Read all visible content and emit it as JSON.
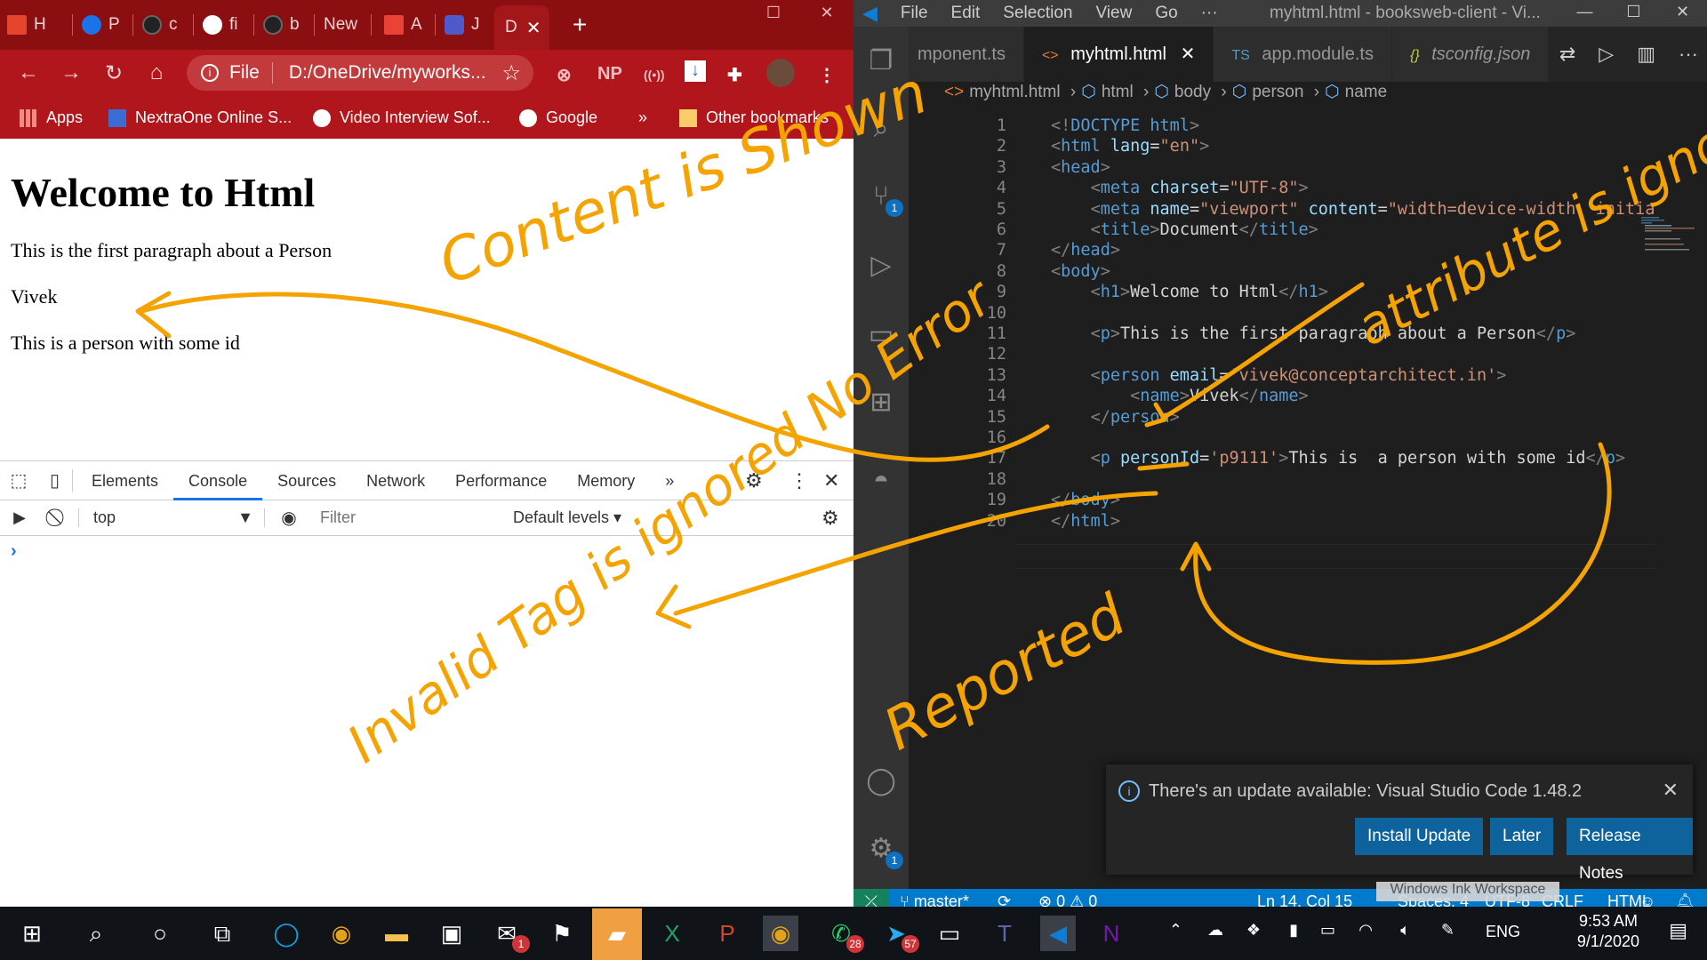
{
  "chrome": {
    "tabs": [
      {
        "label": "H",
        "color": "#e5452d"
      },
      {
        "label": "P",
        "color": "#1a73e8"
      },
      {
        "label": "c",
        "color": "#222222"
      },
      {
        "label": "fi",
        "color": "#ffffff"
      },
      {
        "label": "b",
        "color": "#222222"
      },
      {
        "label": "New",
        "color": ""
      },
      {
        "label": "A",
        "color": "#ea4335"
      },
      {
        "label": "J",
        "color": "#5059c9"
      },
      {
        "label": "D",
        "color": ""
      }
    ],
    "new_tab": "+",
    "omnibox_scheme": "File",
    "omnibox_url": "D:/OneDrive/myworks...",
    "ext_np": "NP",
    "bookmarks": [
      {
        "label": "Apps"
      },
      {
        "label": "NextraOne Online S..."
      },
      {
        "label": "Video Interview Sof..."
      },
      {
        "label": "Google"
      }
    ],
    "bookmarks_more": "»",
    "other_bookmarks": "Other bookmarks"
  },
  "page": {
    "heading": "Welcome to Html",
    "p1": "This is the first paragraph about a Person",
    "p2": "Vivek",
    "p3": "This is a person with some id"
  },
  "devtools": {
    "tabs": [
      "Elements",
      "Console",
      "Sources",
      "Network",
      "Performance",
      "Memory"
    ],
    "more": "»",
    "context": "top",
    "filter_placeholder": "Filter",
    "levels": "Default levels ▾",
    "prompt": "›"
  },
  "vscode": {
    "menu": [
      "File",
      "Edit",
      "Selection",
      "View",
      "Go",
      "···"
    ],
    "title": "myhtml.html - booksweb-client - Vi...",
    "tabs": [
      {
        "icon": "",
        "label": "mponent.ts"
      },
      {
        "icon": "<>",
        "label": "myhtml.html"
      },
      {
        "icon": "TS",
        "label": "app.module.ts"
      },
      {
        "icon": "{}",
        "label": "tsconfig.json"
      }
    ],
    "breadcrumb": [
      "myhtml.html",
      "html",
      "body",
      "person",
      "name"
    ],
    "lines": [
      "<!DOCTYPE html>",
      "<html lang=\"en\">",
      "<head>",
      "    <meta charset=\"UTF-8\">",
      "    <meta name=\"viewport\" content=\"width=device-width, initial",
      "    <title>Document</title>",
      "</head>",
      "<body>",
      "    <h1>Welcome to Html</h1>",
      "",
      "    <p>This is the first paragraph about a Person</p>",
      "",
      "    <person email='vivek@conceptarchitect.in'>",
      "        <name>Vivek</name>",
      "    </person>",
      "",
      "    <p personId='p9111'>This is  a person with some id</p>",
      "",
      "</body>",
      "</html>"
    ],
    "notification": {
      "message": "There's an update available: Visual Studio Code 1.48.2",
      "buttons": [
        "Install Update",
        "Later",
        "Release Notes"
      ]
    },
    "status": {
      "branch": "master*",
      "problems": "0",
      "warnings": "0",
      "position": "Ln 14, Col 15",
      "spaces": "Spaces: 4",
      "encoding": "UTF-8",
      "eol": "CRLF",
      "lang": "HTML"
    },
    "ink_workspace": "Windows Ink Workspace"
  },
  "taskbar": {
    "badge_outlook": "1",
    "badge_whatsapp": "28",
    "badge_telegram": "57",
    "lang": "ENG",
    "time": "9:53 AM",
    "date": "9/1/2020"
  },
  "annotations": {
    "content_shown": "Content is Shown",
    "attribute_ignored": "attribute is ignored",
    "invalid_tag": "Invalid Tag is ignored No Error",
    "reported": "Reported"
  }
}
